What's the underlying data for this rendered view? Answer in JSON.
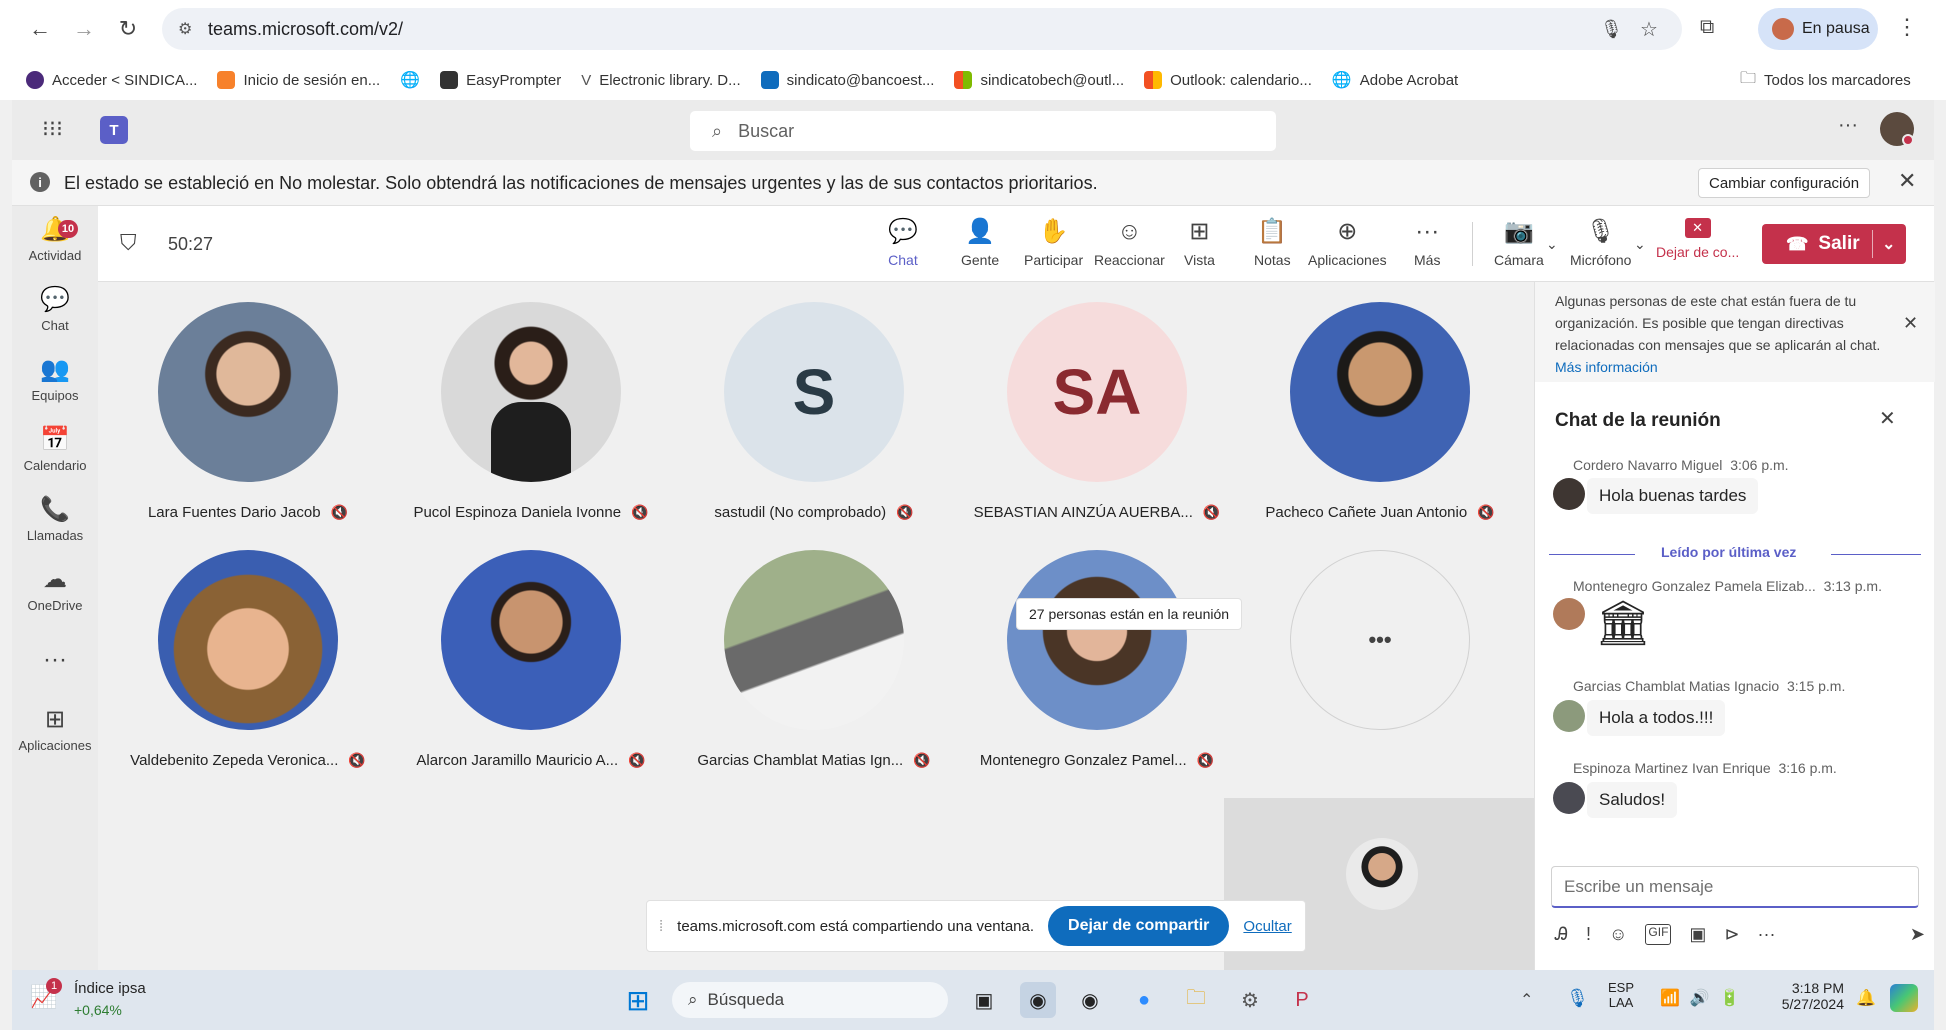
{
  "browser": {
    "url": "teams.microsoft.com/v2/",
    "pause_label": "En pausa",
    "bookmarks": [
      {
        "label": "Acceder < SINDICA...",
        "color": "#4b2a7a"
      },
      {
        "label": "Inicio de sesión en...",
        "color": "#f7812b"
      },
      {
        "label": "",
        "color": "#666666"
      },
      {
        "label": "EasyPrompter",
        "color": "#333333"
      },
      {
        "label": "Electronic library. D...",
        "color": "#555555"
      },
      {
        "label": "sindicato@bancoest...",
        "color": "#0f6cbd"
      },
      {
        "label": "sindicatobech@outl...",
        "color": "#f25022"
      },
      {
        "label": "Outlook: calendario...",
        "color": "#f25022"
      },
      {
        "label": "Adobe Acrobat",
        "color": "#666666"
      }
    ],
    "all_bookmarks": "Todos los marcadores"
  },
  "teams": {
    "search_placeholder": "Buscar",
    "notice": "El estado se estableció en No molestar. Solo obtendrá las notificaciones de mensajes urgentes y las de sus contactos prioritarios.",
    "notice_button": "Cambiar configuración"
  },
  "rail": {
    "activity_badge": "10",
    "items": [
      {
        "label": "Actividad",
        "icon": "bell-icon"
      },
      {
        "label": "Chat",
        "icon": "chat-icon"
      },
      {
        "label": "Equipos",
        "icon": "teams-icon"
      },
      {
        "label": "Calendario",
        "icon": "calendar-icon"
      },
      {
        "label": "Llamadas",
        "icon": "phone-icon"
      },
      {
        "label": "OneDrive",
        "icon": "cloud-icon"
      },
      {
        "label": "",
        "icon": "more-icon"
      },
      {
        "label": "Aplicaciones",
        "icon": "add-app-icon"
      }
    ]
  },
  "meeting": {
    "timer": "50:27",
    "toolbar": [
      "Chat",
      "Gente",
      "Participar",
      "Reaccionar",
      "Vista",
      "Notas",
      "Aplicaciones",
      "Más"
    ],
    "camera": "Cámara",
    "mic": "Micrófono",
    "stop_share": "Dejar de co...",
    "leave": "Salir",
    "leave_color": "#c4314b"
  },
  "participants": [
    {
      "name": "Lara Fuentes Dario Jacob",
      "type": "photo",
      "bg": "#6b7f99"
    },
    {
      "name": "Pucol Espinoza Daniela Ivonne",
      "type": "photo",
      "bg": "#d9d9d9"
    },
    {
      "name": "sastudil (No comprobado)",
      "type": "initials",
      "initials": "S",
      "bg": "#dbe3ea",
      "fg": "#2a3b46"
    },
    {
      "name": "SEBASTIAN AINZÚA AUERBA...",
      "type": "initials",
      "initials": "SA",
      "bg": "#f6dcdc",
      "fg": "#8a2a30"
    },
    {
      "name": "Pacheco Cañete Juan Antonio",
      "type": "photo",
      "bg": "#3f63b3"
    },
    {
      "name": "Valdebenito Zepeda Veronica...",
      "type": "photo",
      "bg": "#9a7a4e"
    },
    {
      "name": "Alarcon Jaramillo Mauricio A...",
      "type": "photo",
      "bg": "#3b5fb8"
    },
    {
      "name": "Garcias Chamblat Matias Ign...",
      "type": "photo",
      "bg": "#8c9a7c"
    },
    {
      "name": "Montenegro Gonzalez Pamel...",
      "type": "photo",
      "bg": "#6d8fc8"
    }
  ],
  "overflow": {
    "label": "•••",
    "tooltip": "27 personas están en la reunión"
  },
  "share_bar": {
    "text": "teams.microsoft.com está compartiendo una ventana.",
    "stop": "Dejar de compartir",
    "hide": "Ocultar"
  },
  "chat": {
    "banner": "Algunas personas de este chat están fuera de tu organización. Es posible que tengan directivas relacionadas con mensajes que se aplicarán al chat.",
    "banner_link": "Más información",
    "title": "Chat de la reunión",
    "last_read": "Leído por última vez",
    "compose_placeholder": "Escribe un mensaje",
    "messages": [
      {
        "author": "Cordero Navarro Miguel",
        "time": "3:06 p.m.",
        "text": "Hola buenas tardes"
      },
      {
        "author": "Montenegro Gonzalez Pamela Elizab...",
        "time": "3:13 p.m.",
        "text": ""
      },
      {
        "author": "Garcias Chamblat Matias Ignacio",
        "time": "3:15 p.m.",
        "text": "Hola a todos.!!!"
      },
      {
        "author": "Espinoza Martinez Ivan Enrique",
        "time": "3:16 p.m.",
        "text": "Saludos!"
      }
    ]
  },
  "taskbar": {
    "weather_title": "Índice ipsa",
    "weather_value": "+0,64%",
    "weather_badge": "1",
    "search": "Búsqueda",
    "lang1": "ESP",
    "lang2": "LAA",
    "time": "3:18 PM",
    "date": "5/27/2024"
  }
}
